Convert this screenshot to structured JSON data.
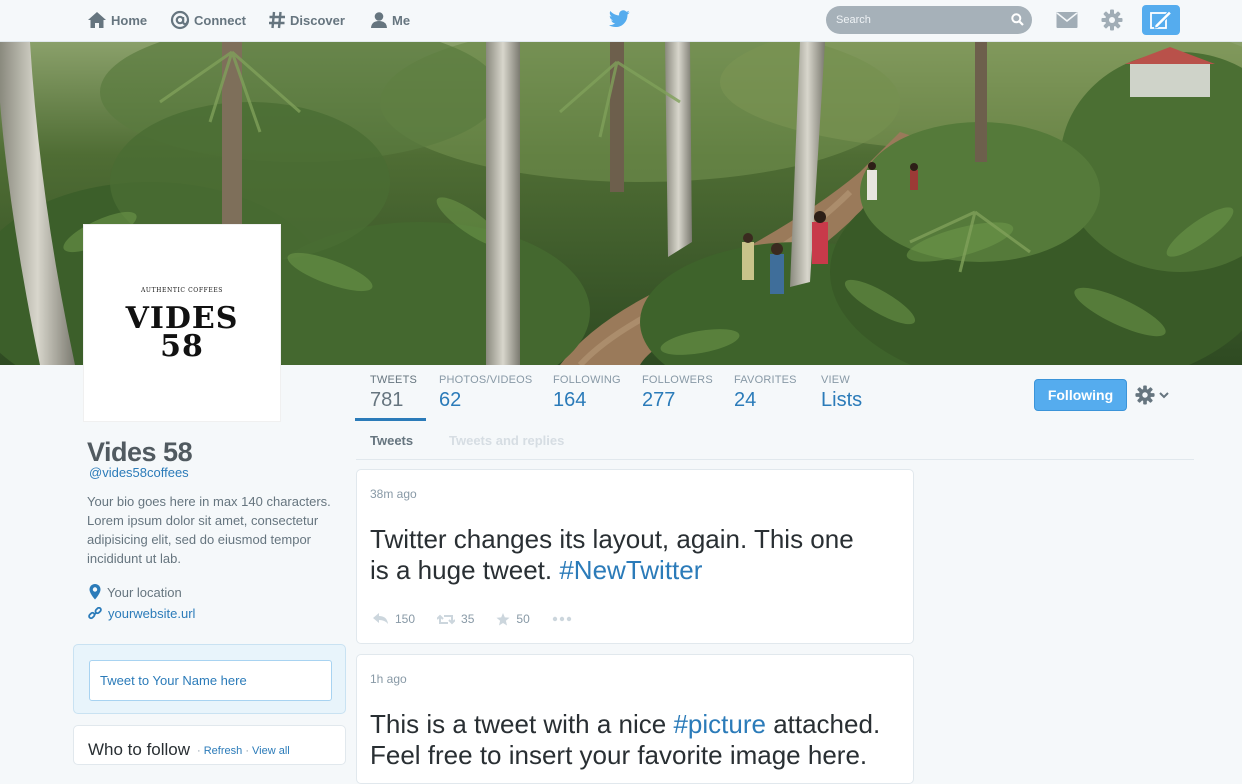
{
  "topbar": {
    "nav": [
      {
        "label": "Home",
        "icon": "home-icon"
      },
      {
        "label": "Connect",
        "icon": "at-icon"
      },
      {
        "label": "Discover",
        "icon": "hashtag-icon"
      },
      {
        "label": "Me",
        "icon": "person-icon"
      }
    ],
    "search_placeholder": "Search"
  },
  "profile": {
    "logo_small": "AUTHENTIC COFFEES",
    "logo_line1": "VIDES",
    "logo_line2": "58",
    "name": "Vides 58",
    "handle": "@vides58coffees",
    "bio": "Your bio goes here in max 140 characters. Lorem ipsum dolor sit amet, consectetur adipisicing elit, sed do eiusmod tempor incididunt ut lab.",
    "location": "Your location",
    "website": "yourwebsite.url"
  },
  "stats": [
    {
      "label": "TWEETS",
      "value": "781"
    },
    {
      "label": "PHOTOS/VIDEOS",
      "value": "62"
    },
    {
      "label": "FOLLOWING",
      "value": "164"
    },
    {
      "label": "FOLLOWERS",
      "value": "277"
    },
    {
      "label": "FAVORITES",
      "value": "24"
    },
    {
      "label": "VIEW",
      "value": "Lists"
    }
  ],
  "follow_button": "Following",
  "tabs": {
    "tweets": "Tweets",
    "replies": "Tweets and replies"
  },
  "tweetbox": {
    "placeholder": "Tweet to Your Name here"
  },
  "who_to_follow": {
    "title": "Who to follow",
    "sep1": " · ",
    "refresh": "Refresh",
    "sep2": " · ",
    "view_all": "View all"
  },
  "tweets": [
    {
      "time": "38m ago",
      "line1": "Twitter changes its layout, again. This one",
      "line2": "is a huge tweet. ",
      "hashtag": "#NewTwitter",
      "replies": "150",
      "retweets": "35",
      "favorites": "50"
    },
    {
      "time": "1h ago",
      "line1": "This is a tweet with a nice ",
      "hashtag": "#picture",
      "line1_end": " attached.",
      "line2": "Feel free to insert your favorite image here."
    }
  ],
  "colors": {
    "accent": "#55acee",
    "link": "#2b7bb9",
    "muted": "#8899a6"
  }
}
